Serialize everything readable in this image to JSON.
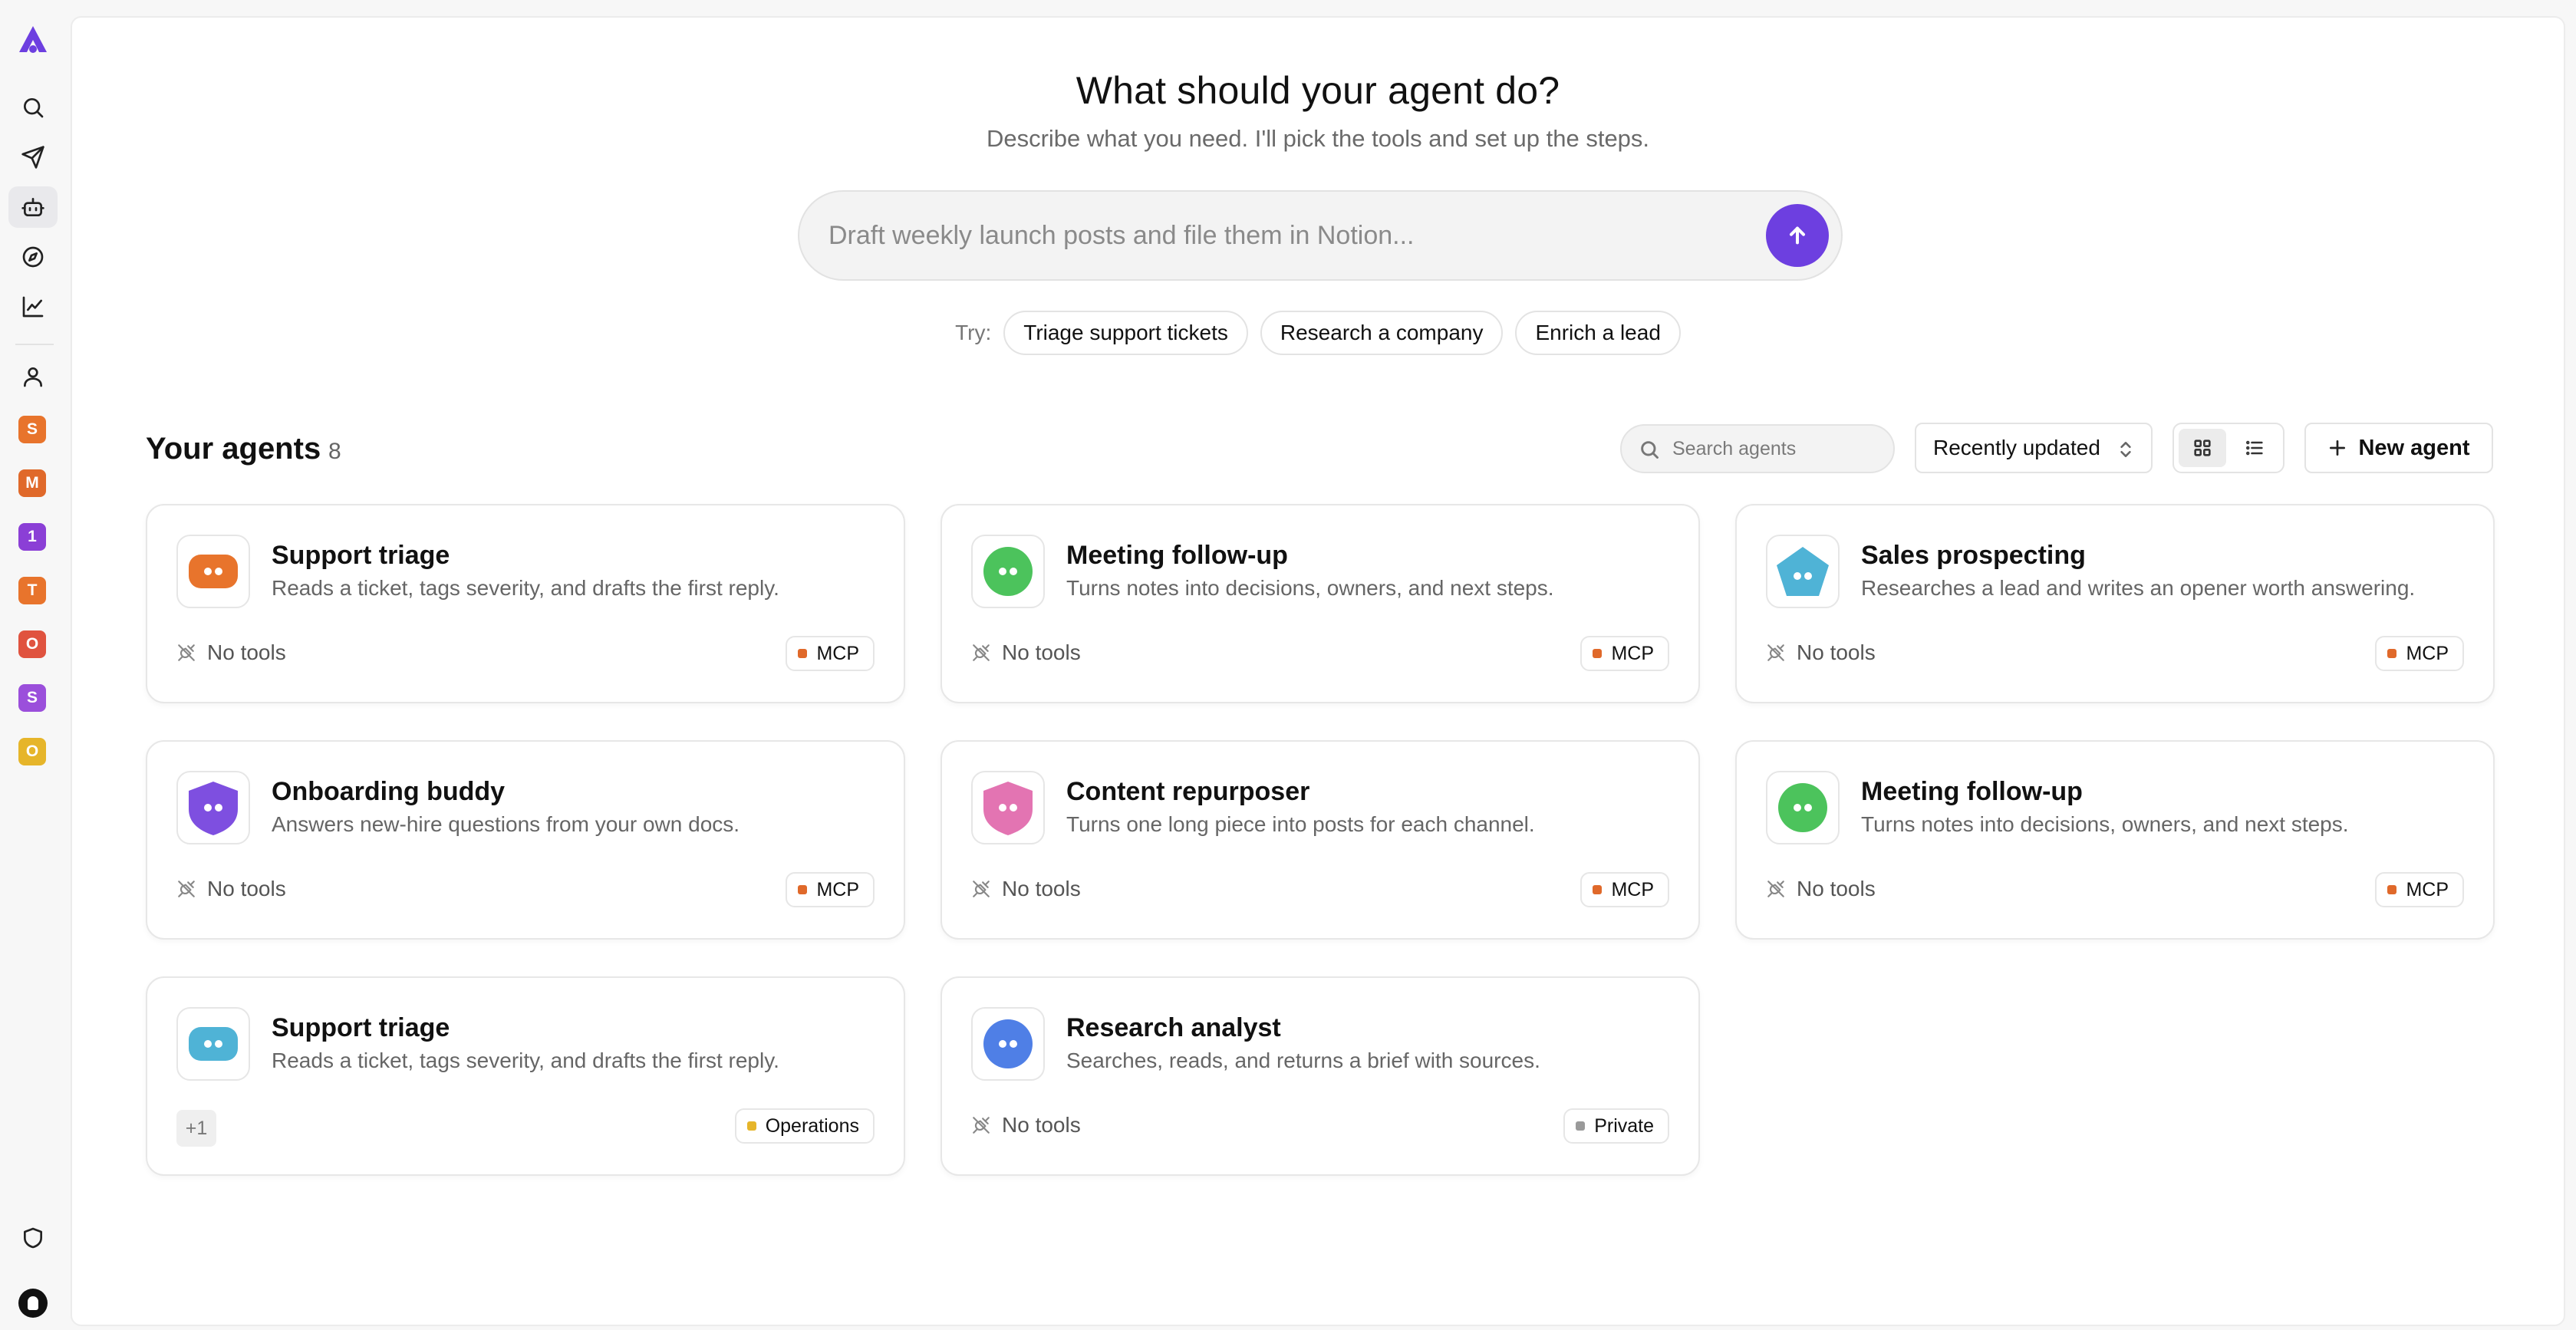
{
  "sidebar": {
    "workspaces": [
      {
        "letter": "S",
        "color": "#e8742c"
      },
      {
        "letter": "M",
        "color": "#e0692a"
      },
      {
        "letter": "1",
        "color": "#8b3fd6"
      },
      {
        "letter": "T",
        "color": "#e8742c"
      },
      {
        "letter": "O",
        "color": "#e0533f"
      },
      {
        "letter": "S",
        "color": "#9b4fdb"
      },
      {
        "letter": "O",
        "color": "#e6b52a"
      }
    ]
  },
  "hero": {
    "title": "What should your agent do?",
    "subtitle": "Describe what you need. I'll pick the tools and set up the steps.",
    "prompt_placeholder": "Draft weekly launch posts and file them in Notion...",
    "prompt_value": "",
    "try_label": "Try:",
    "suggestions": [
      "Triage support tickets",
      "Research a company",
      "Enrich a lead"
    ]
  },
  "agents_header": {
    "title": "Your agents",
    "count": "8",
    "search_placeholder": "Search agents",
    "sort_label": "Recently updated",
    "new_agent_label": "New agent",
    "view_mode": "grid"
  },
  "agents": [
    {
      "name": "Support triage",
      "description": "Reads a ticket, tags severity, and drafts the first reply.",
      "icon": "rounded-square-avatar",
      "icon_color": "#e8742c",
      "tools": "No tools",
      "tag": "MCP",
      "tag_color": "#e0692a"
    },
    {
      "name": "Meeting follow-up",
      "description": "Turns notes into decisions, owners, and next steps.",
      "icon": "circle-avatar",
      "icon_color": "#4cc35c",
      "tools": "No tools",
      "tag": "MCP",
      "tag_color": "#e0692a"
    },
    {
      "name": "Sales prospecting",
      "description": "Researches a lead and writes an opener worth answering.",
      "icon": "pentagon-avatar",
      "icon_color": "#4fb3d6",
      "tools": "No tools",
      "tag": "MCP",
      "tag_color": "#e0692a"
    },
    {
      "name": "Onboarding buddy",
      "description": "Answers new-hire questions from your own docs.",
      "icon": "shield-avatar",
      "icon_color": "#7e4fe0",
      "tools": "No tools",
      "tag": "MCP",
      "tag_color": "#e0692a"
    },
    {
      "name": "Content repurposer",
      "description": "Turns one long piece into posts for each channel.",
      "icon": "shield-avatar",
      "icon_color": "#e374b2",
      "tools": "No tools",
      "tag": "MCP",
      "tag_color": "#e0692a"
    },
    {
      "name": "Meeting follow-up",
      "description": "Turns notes into decisions, owners, and next steps.",
      "icon": "circle-avatar",
      "icon_color": "#4cc35c",
      "tools": "No tools",
      "tag": "MCP",
      "tag_color": "#e0692a"
    },
    {
      "name": "Support triage",
      "description": "Reads a ticket, tags severity, and drafts the first reply.",
      "icon": "rounded-square-avatar",
      "icon_color": "#4fb3d6",
      "tools": "+1",
      "tag": "Operations",
      "tag_color": "#e6b52a"
    },
    {
      "name": "Research analyst",
      "description": "Searches, reads, and returns a brief with sources.",
      "icon": "circle-avatar",
      "icon_color": "#4f7fe6",
      "tools": "No tools",
      "tag": "Private",
      "tag_color": "#9a9a9a"
    }
  ],
  "colors": {
    "accent": "#6d3fe0"
  }
}
